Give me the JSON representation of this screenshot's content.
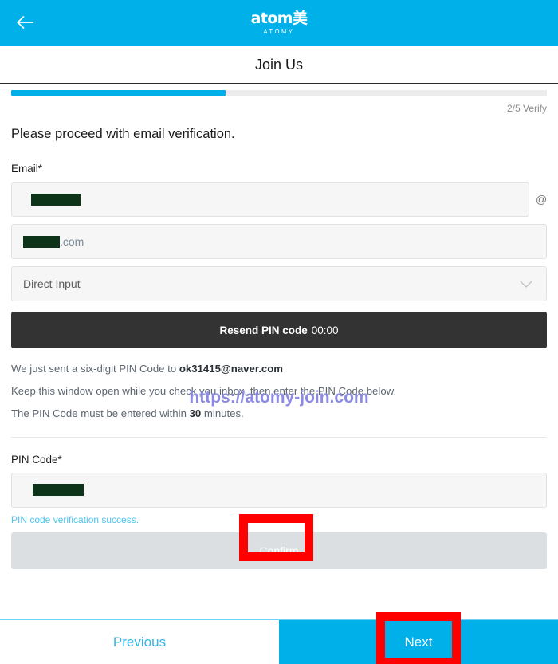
{
  "theme": {
    "accent": "#00b0e8",
    "dark_button": "#333333",
    "disabled_button": "#dcdfe1",
    "annotation": "#ff0000",
    "success_text": "#4ec4f0",
    "redaction": "#0d3318",
    "watermark": "#8b8be6"
  },
  "topbar": {
    "back_icon": "arrow-left-icon",
    "brand_mark": "atom美",
    "brand_sub": "ATOMY"
  },
  "header": {
    "title": "Join Us"
  },
  "progress": {
    "percent": 40,
    "step_label": "2/5 Verify"
  },
  "main": {
    "lead": "Please proceed with email verification.",
    "email": {
      "label": "Email*",
      "local_value": "",
      "local_placeholder": "",
      "at_symbol": "@",
      "domain_value": ".com",
      "domain_placeholder": "",
      "select_value": "Direct Input",
      "select_icon": "chevron-down-icon",
      "select_options": [
        "Direct Input"
      ]
    },
    "resend": {
      "label": "Resend PIN code",
      "timer": "00:00"
    },
    "info": {
      "line1_prefix": "We just sent a six-digit PIN Code to ",
      "line1_email": "ok31415@naver.com",
      "line2": "Keep this window open while you check you inbox, then enter the PIN Code below.",
      "line3_prefix": "The PIN Code must be entered within ",
      "line3_strong": "30",
      "line3_suffix": " minutes."
    },
    "pin": {
      "label": "PIN Code*",
      "value": "",
      "placeholder": "",
      "success_message": "PIN code verification success.",
      "confirm_label": "Confirm"
    }
  },
  "watermark": {
    "text": "https://atomy-join.com"
  },
  "footer": {
    "previous_label": "Previous",
    "next_label": "Next"
  }
}
